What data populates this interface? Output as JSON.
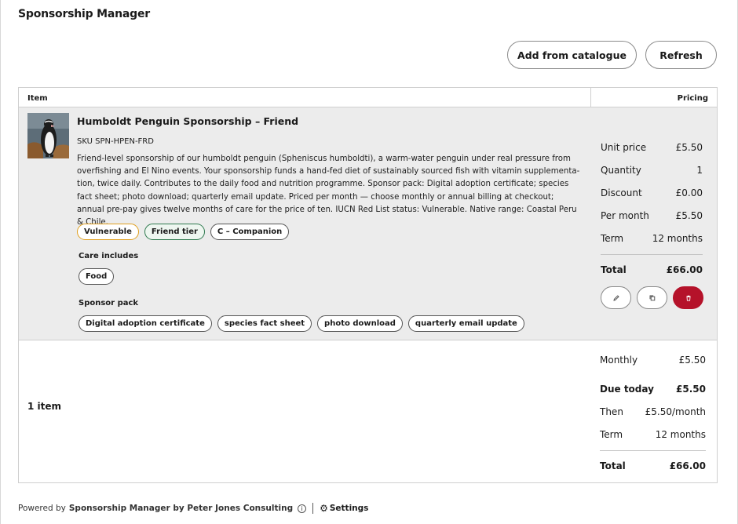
{
  "app": {
    "title": "Sponsorship Manager"
  },
  "toolbar": {
    "add_label": "Add from catalogue",
    "refresh_label": "Refresh"
  },
  "table": {
    "col_item": "Item",
    "col_pricing": "Pricing"
  },
  "item": {
    "title": "Humboldt Penguin Sponsorship – Friend",
    "sku": "SKU SPN-HPEN-FRD",
    "description": "Friend-level sponsorship of our humboldt penguin (Spheniscus humboldti), a warm-water penguin under real pressure from overfishing and El Nino events. Your sponsorship funds a hand-fed diet of sustainably sourced fish with vitamin supplementa-tion, twice daily. Contributes to the daily food and nutrition programme. Sponsor pack: Digital adoption certificate; species fact sheet; photo download; quarterly email update. Priced per month — choose monthly or annual billing at checkout; annual pre-pay gives twelve months of care for the price of ten. IUCN Red List status: Vulnerable. Native range: Coastal Peru & Chile.",
    "tags": [
      "Vulnerable",
      "Friend tier",
      "C – Companion"
    ],
    "care_label": "Care includes",
    "care": [
      "Food"
    ],
    "pack_label": "Sponsor pack",
    "pack": [
      "Digital adoption certificate",
      "species fact sheet",
      "photo download",
      "quarterly email update"
    ]
  },
  "pricing": {
    "unit_price_k": "Unit price",
    "unit_price_v": "£5.50",
    "quantity_k": "Quantity",
    "quantity_v": "1",
    "discount_k": "Discount",
    "discount_v": "£0.00",
    "per_month_k": "Per month",
    "per_month_v": "£5.50",
    "term_k": "Term",
    "term_v": "12 months",
    "total_k": "Total",
    "total_v": "£66.00"
  },
  "summary": {
    "count": "1 item",
    "monthly_k": "Monthly",
    "monthly_v": "£5.50",
    "due_k": "Due today",
    "due_v": "£5.50",
    "then_k": "Then",
    "then_v": "£5.50/month",
    "term_k": "Term",
    "term_v": "12 months",
    "total_k": "Total",
    "total_v": "£66.00"
  },
  "footer": {
    "powered": "Powered by",
    "brand": "Sponsorship Manager by Peter Jones Consulting",
    "info_glyph": "i",
    "settings_label": "Settings"
  },
  "colors": {
    "delete": "#b5122a",
    "vulnerable_border": "#e0a020",
    "friend_border": "#2f7a4f",
    "row_bg": "#ececec"
  }
}
